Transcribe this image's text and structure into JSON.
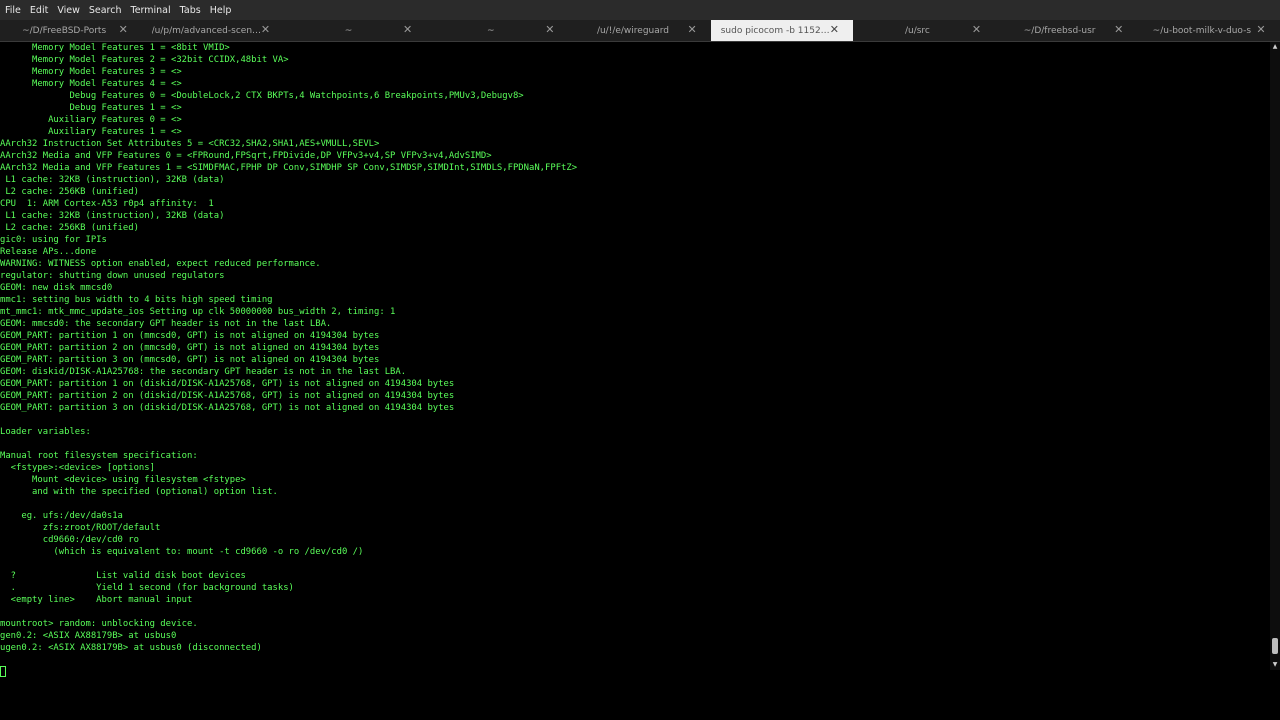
{
  "menu": {
    "file": "File",
    "edit": "Edit",
    "view": "View",
    "search": "Search",
    "terminal": "Terminal",
    "tabs": "Tabs",
    "help": "Help"
  },
  "tabs": [
    {
      "title": "~/D/FreeBSD-Ports",
      "active": false
    },
    {
      "title": "/u/p/m/advanced-scen…",
      "active": false
    },
    {
      "title": "~",
      "active": false
    },
    {
      "title": "~",
      "active": false
    },
    {
      "title": "/u/!/e/wireguard",
      "active": false
    },
    {
      "title": "sudo picocom -b 1152…",
      "active": true
    },
    {
      "title": "/u/src",
      "active": false
    },
    {
      "title": "~/D/freebsd-usr",
      "active": false
    },
    {
      "title": "~/u-boot-milk-v-duo-s",
      "active": false
    }
  ],
  "terminal": {
    "lines": [
      "      Memory Model Features 1 = <8bit VMID>",
      "      Memory Model Features 2 = <32bit CCIDX,48bit VA>",
      "      Memory Model Features 3 = <>",
      "      Memory Model Features 4 = <>",
      "             Debug Features 0 = <DoubleLock,2 CTX BKPTs,4 Watchpoints,6 Breakpoints,PMUv3,Debugv8>",
      "             Debug Features 1 = <>",
      "         Auxiliary Features 0 = <>",
      "         Auxiliary Features 1 = <>",
      "AArch32 Instruction Set Attributes 5 = <CRC32,SHA2,SHA1,AES+VMULL,SEVL>",
      "AArch32 Media and VFP Features 0 = <FPRound,FPSqrt,FPDivide,DP VFPv3+v4,SP VFPv3+v4,AdvSIMD>",
      "AArch32 Media and VFP Features 1 = <SIMDFMAC,FPHP DP Conv,SIMDHP SP Conv,SIMDSP,SIMDInt,SIMDLS,FPDNaN,FPFtZ>",
      " L1 cache: 32KB (instruction), 32KB (data)",
      " L2 cache: 256KB (unified)",
      "CPU  1: ARM Cortex-A53 r0p4 affinity:  1",
      " L1 cache: 32KB (instruction), 32KB (data)",
      " L2 cache: 256KB (unified)",
      "gic0: using for IPIs",
      "Release APs...done",
      "WARNING: WITNESS option enabled, expect reduced performance.",
      "regulator: shutting down unused regulators",
      "GEOM: new disk mmcsd0",
      "mmc1: setting bus width to 4 bits high speed timing",
      "mt_mmc1: mtk_mmc_update_ios Setting up clk 50000000 bus_width 2, timing: 1",
      "GEOM: mmcsd0: the secondary GPT header is not in the last LBA.",
      "GEOM_PART: partition 1 on (mmcsd0, GPT) is not aligned on 4194304 bytes",
      "GEOM_PART: partition 2 on (mmcsd0, GPT) is not aligned on 4194304 bytes",
      "GEOM_PART: partition 3 on (mmcsd0, GPT) is not aligned on 4194304 bytes",
      "GEOM: diskid/DISK-A1A25768: the secondary GPT header is not in the last LBA.",
      "GEOM_PART: partition 1 on (diskid/DISK-A1A25768, GPT) is not aligned on 4194304 bytes",
      "GEOM_PART: partition 2 on (diskid/DISK-A1A25768, GPT) is not aligned on 4194304 bytes",
      "GEOM_PART: partition 3 on (diskid/DISK-A1A25768, GPT) is not aligned on 4194304 bytes",
      "",
      "Loader variables:",
      "",
      "Manual root filesystem specification:",
      "  <fstype>:<device> [options]",
      "      Mount <device> using filesystem <fstype>",
      "      and with the specified (optional) option list.",
      "",
      "    eg. ufs:/dev/da0s1a",
      "        zfs:zroot/ROOT/default",
      "        cd9660:/dev/cd0 ro",
      "          (which is equivalent to: mount -t cd9660 -o ro /dev/cd0 /)",
      "",
      "  ?               List valid disk boot devices",
      "  .               Yield 1 second (for background tasks)",
      "  <empty line>    Abort manual input",
      "",
      "mountroot> random: unblocking device.",
      "gen0.2: <ASIX AX88179B> at usbus0",
      "ugen0.2: <ASIX AX88179B> at usbus0 (disconnected)"
    ]
  },
  "colors": {
    "terminal_fg": "#5aff5a",
    "terminal_bg": "#000000",
    "menubar_bg": "#2b2b2b",
    "tabbar_bg": "#1f1f1f",
    "active_tab_bg": "#efefef"
  },
  "icons": {
    "tab_close": "close-icon",
    "scroll_up": "arrow-up-icon",
    "scroll_down": "arrow-down-icon"
  },
  "glyphs": {
    "close": "✕",
    "up": "▲",
    "down": "▼"
  }
}
